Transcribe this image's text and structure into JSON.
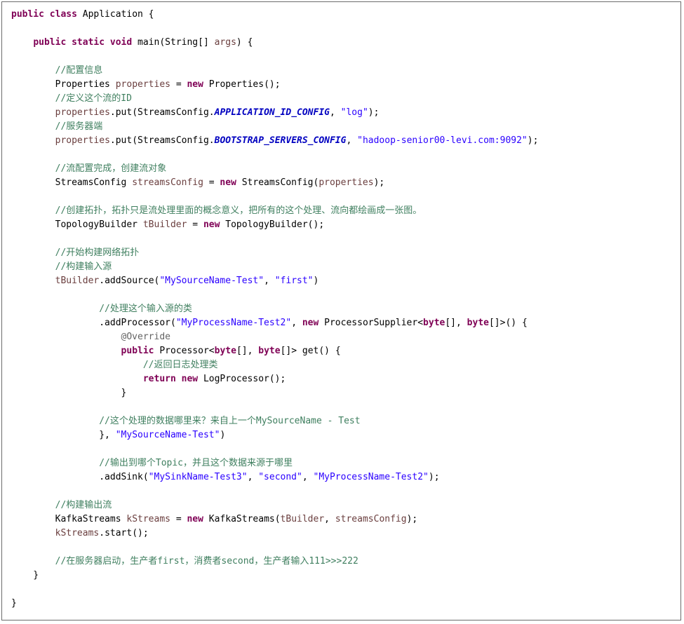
{
  "code": {
    "language": "java",
    "lines": [
      [
        {
          "t": "public class ",
          "c": "kw"
        },
        {
          "t": "Application {",
          "c": ""
        }
      ],
      [],
      [
        {
          "t": "    ",
          "c": ""
        },
        {
          "t": "public static void ",
          "c": "kw"
        },
        {
          "t": "main(String[] ",
          "c": ""
        },
        {
          "t": "args",
          "c": "var"
        },
        {
          "t": ") {",
          "c": ""
        }
      ],
      [],
      [
        {
          "t": "        //配置信息",
          "c": "cm"
        }
      ],
      [
        {
          "t": "        Properties ",
          "c": ""
        },
        {
          "t": "properties",
          "c": "var"
        },
        {
          "t": " = ",
          "c": ""
        },
        {
          "t": "new ",
          "c": "kw"
        },
        {
          "t": "Properties();",
          "c": ""
        }
      ],
      [
        {
          "t": "        //定义这个流的ID",
          "c": "cm"
        }
      ],
      [
        {
          "t": "        ",
          "c": ""
        },
        {
          "t": "properties",
          "c": "var"
        },
        {
          "t": ".put(StreamsConfig.",
          "c": ""
        },
        {
          "t": "APPLICATION_ID_CONFIG",
          "c": "fld"
        },
        {
          "t": ", ",
          "c": ""
        },
        {
          "t": "\"log\"",
          "c": "str"
        },
        {
          "t": ");",
          "c": ""
        }
      ],
      [
        {
          "t": "        //服务器端",
          "c": "cm"
        }
      ],
      [
        {
          "t": "        ",
          "c": ""
        },
        {
          "t": "properties",
          "c": "var"
        },
        {
          "t": ".put(StreamsConfig.",
          "c": ""
        },
        {
          "t": "BOOTSTRAP_SERVERS_CONFIG",
          "c": "fld"
        },
        {
          "t": ", ",
          "c": ""
        },
        {
          "t": "\"hadoop-senior00-levi.com:9092\"",
          "c": "str"
        },
        {
          "t": ");",
          "c": ""
        }
      ],
      [],
      [
        {
          "t": "        //流配置完成，创建流对象",
          "c": "cm"
        }
      ],
      [
        {
          "t": "        StreamsConfig ",
          "c": ""
        },
        {
          "t": "streamsConfig",
          "c": "var"
        },
        {
          "t": " = ",
          "c": ""
        },
        {
          "t": "new ",
          "c": "kw"
        },
        {
          "t": "StreamsConfig(",
          "c": ""
        },
        {
          "t": "properties",
          "c": "var"
        },
        {
          "t": ");",
          "c": ""
        }
      ],
      [],
      [
        {
          "t": "        //创建拓扑，拓扑只是流处理里面的概念意义，把所有的这个处理、流向都绘画成一张图。",
          "c": "cm"
        }
      ],
      [
        {
          "t": "        TopologyBuilder ",
          "c": ""
        },
        {
          "t": "tBuilder",
          "c": "var"
        },
        {
          "t": " = ",
          "c": ""
        },
        {
          "t": "new ",
          "c": "kw"
        },
        {
          "t": "TopologyBuilder();",
          "c": ""
        }
      ],
      [],
      [
        {
          "t": "        //开始构建网络拓扑",
          "c": "cm"
        }
      ],
      [
        {
          "t": "        //构建输入源",
          "c": "cm"
        }
      ],
      [
        {
          "t": "        ",
          "c": ""
        },
        {
          "t": "tBuilder",
          "c": "var"
        },
        {
          "t": ".addSource(",
          "c": ""
        },
        {
          "t": "\"MySourceName-Test\"",
          "c": "str"
        },
        {
          "t": ", ",
          "c": ""
        },
        {
          "t": "\"first\"",
          "c": "str"
        },
        {
          "t": ")",
          "c": ""
        }
      ],
      [],
      [
        {
          "t": "                //处理这个输入源的类",
          "c": "cm"
        }
      ],
      [
        {
          "t": "                .addProcessor(",
          "c": ""
        },
        {
          "t": "\"MyProcessName-Test2\"",
          "c": "str"
        },
        {
          "t": ", ",
          "c": ""
        },
        {
          "t": "new ",
          "c": "kw"
        },
        {
          "t": "ProcessorSupplier<",
          "c": ""
        },
        {
          "t": "byte",
          "c": "kw"
        },
        {
          "t": "[], ",
          "c": ""
        },
        {
          "t": "byte",
          "c": "kw"
        },
        {
          "t": "[]>() {",
          "c": ""
        }
      ],
      [
        {
          "t": "                    @Override",
          "c": "ann"
        }
      ],
      [
        {
          "t": "                    ",
          "c": ""
        },
        {
          "t": "public ",
          "c": "kw"
        },
        {
          "t": "Processor<",
          "c": ""
        },
        {
          "t": "byte",
          "c": "kw"
        },
        {
          "t": "[], ",
          "c": ""
        },
        {
          "t": "byte",
          "c": "kw"
        },
        {
          "t": "[]> get() {",
          "c": ""
        }
      ],
      [
        {
          "t": "                        //返回日志处理类",
          "c": "cm"
        }
      ],
      [
        {
          "t": "                        ",
          "c": ""
        },
        {
          "t": "return new ",
          "c": "kw"
        },
        {
          "t": "LogProcessor();",
          "c": ""
        }
      ],
      [
        {
          "t": "                    }",
          "c": ""
        }
      ],
      [],
      [
        {
          "t": "                //这个处理的数据哪里来？来自上一个MySourceName - Test",
          "c": "cm"
        }
      ],
      [
        {
          "t": "                }, ",
          "c": ""
        },
        {
          "t": "\"MySourceName-Test\"",
          "c": "str"
        },
        {
          "t": ")",
          "c": ""
        }
      ],
      [],
      [
        {
          "t": "                //输出到哪个Topic，并且这个数据来源于哪里",
          "c": "cm"
        }
      ],
      [
        {
          "t": "                .addSink(",
          "c": ""
        },
        {
          "t": "\"MySinkName-Test3\"",
          "c": "str"
        },
        {
          "t": ", ",
          "c": ""
        },
        {
          "t": "\"second\"",
          "c": "str"
        },
        {
          "t": ", ",
          "c": ""
        },
        {
          "t": "\"MyProcessName-Test2\"",
          "c": "str"
        },
        {
          "t": ");",
          "c": ""
        }
      ],
      [],
      [
        {
          "t": "        //构建输出流",
          "c": "cm"
        }
      ],
      [
        {
          "t": "        KafkaStreams ",
          "c": ""
        },
        {
          "t": "kStreams",
          "c": "var"
        },
        {
          "t": " = ",
          "c": ""
        },
        {
          "t": "new ",
          "c": "kw"
        },
        {
          "t": "KafkaStreams(",
          "c": ""
        },
        {
          "t": "tBuilder",
          "c": "var"
        },
        {
          "t": ", ",
          "c": ""
        },
        {
          "t": "streamsConfig",
          "c": "var"
        },
        {
          "t": ");",
          "c": ""
        }
      ],
      [
        {
          "t": "        ",
          "c": ""
        },
        {
          "t": "kStreams",
          "c": "var"
        },
        {
          "t": ".start();",
          "c": ""
        }
      ],
      [],
      [
        {
          "t": "        //在服务器启动，生产者first，消费者second，生产者输入111>>>222",
          "c": "cm"
        }
      ],
      [
        {
          "t": "    }",
          "c": ""
        }
      ],
      [],
      [
        {
          "t": "}",
          "c": ""
        }
      ]
    ]
  }
}
